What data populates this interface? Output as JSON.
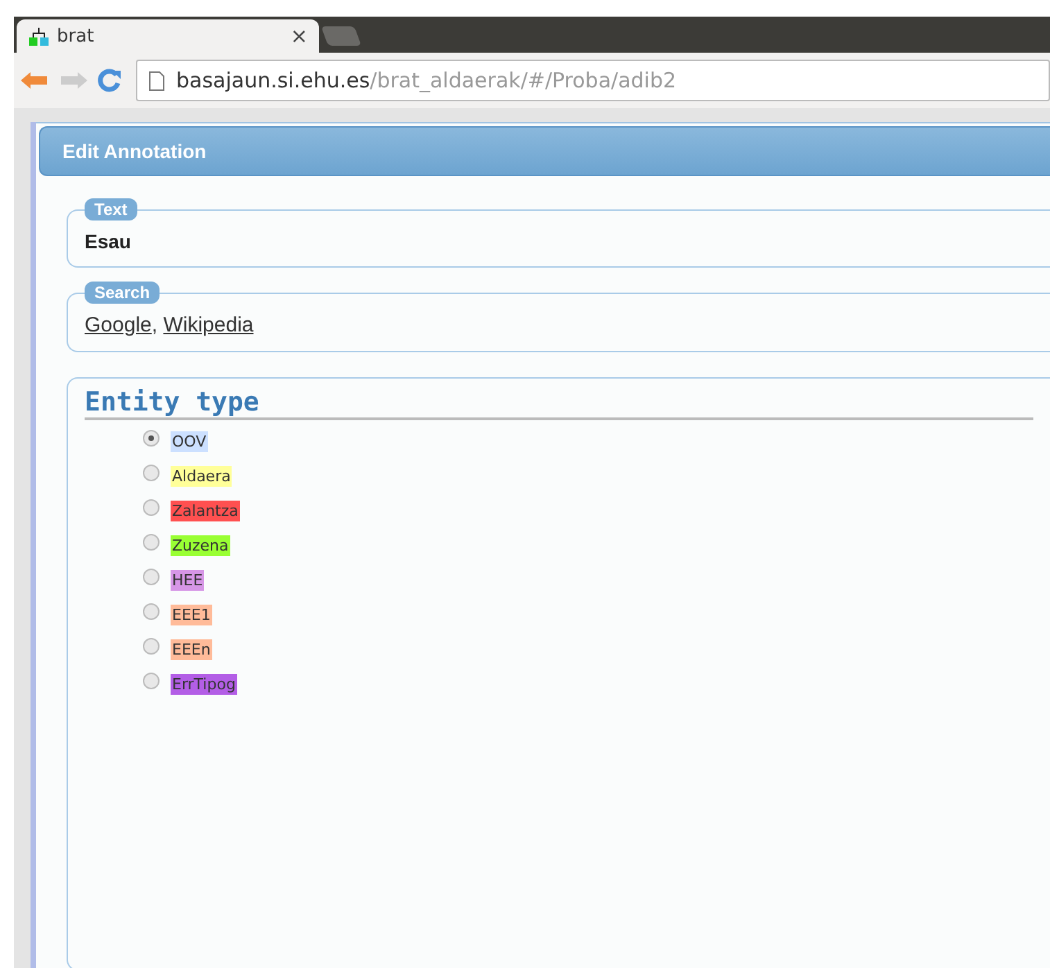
{
  "browser": {
    "tab_title": "brat",
    "tab_close": "×",
    "url_host": "basajaun.si.ehu.es",
    "url_path": "/brat_aldaerak/#/Proba/adib2"
  },
  "dialog": {
    "title": "Edit Annotation",
    "text_section": {
      "legend": "Text",
      "value": "Esau"
    },
    "search_section": {
      "legend": "Search",
      "links": [
        "Google",
        "Wikipedia"
      ],
      "separator": ", "
    },
    "entity_section": {
      "heading": "Entity type",
      "types": [
        {
          "label": "OOV",
          "color": "#cce0ff",
          "selected": true
        },
        {
          "label": "Aldaera",
          "color": "#ffff99",
          "selected": false
        },
        {
          "label": "Zalantza",
          "color": "#ff5050",
          "selected": false
        },
        {
          "label": "Zuzena",
          "color": "#99ff33",
          "selected": false
        },
        {
          "label": "HEE",
          "color": "#d696e6",
          "selected": false
        },
        {
          "label": "EEE1",
          "color": "#ffbb99",
          "selected": false
        },
        {
          "label": "EEEn",
          "color": "#ffbb99",
          "selected": false
        },
        {
          "label": "ErrTipog",
          "color": "#b35ee6",
          "selected": false
        }
      ]
    }
  }
}
